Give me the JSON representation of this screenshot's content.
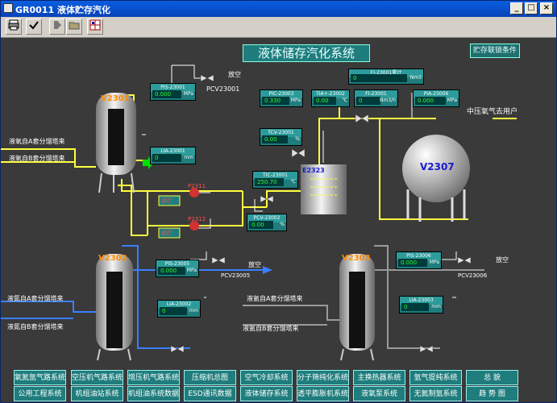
{
  "window": {
    "title": "GR0011  液体贮存汽化",
    "min_label": "_",
    "max_label": "□",
    "close_label": "×"
  },
  "toolbar": {
    "print_icon": "printer-icon",
    "check_icon": "check-icon",
    "fwd_icon": "forward-icon",
    "open_icon": "folder-icon",
    "grid_icon": "grid-icon"
  },
  "header": {
    "title": "液体储存汽化系统",
    "link_label": "贮存联锁条件"
  },
  "tanks": {
    "v2301": "V2301",
    "v2302": "V2302",
    "v2303": "V2303",
    "v2307": "V2307",
    "e2323": "E2323"
  },
  "inlets": {
    "top_a": "液氧自A套分馏塔来",
    "top_b": "液氧自B套分馏塔来",
    "mid_a": "液氮自A套分馏塔来",
    "mid_b": "液氮自B套分馏塔来",
    "right_a": "液氩自A套分馏塔来",
    "right_b": "液氩自B套分馏塔来"
  },
  "outlets": {
    "vent1": "放空",
    "vent2": "放空",
    "vent3": "放空",
    "user": "中压氧气去用户"
  },
  "valves": {
    "pcv23001": "PCV23001",
    "pcv23002": "PCV23002",
    "pcv23005": "PCV23005",
    "pcv23006": "PCV23006"
  },
  "pumps": {
    "p2311": "P2311",
    "p2312": "P2312",
    "p2311_state": "运行",
    "p2312_state": "运行"
  },
  "instruments": {
    "pis23001": {
      "tag": "PIS-23001",
      "value": "0.000",
      "unit": "MPa"
    },
    "lia23001": {
      "tag": "LIA-23001",
      "value": "0",
      "unit": "mm"
    },
    "pic23003": {
      "tag": "PIC-23003",
      "value": "0.330",
      "unit": "MPa"
    },
    "tia23002": {
      "tag": "TIA+-23002",
      "value": "0.00",
      "unit": "℃"
    },
    "fi23001": {
      "tag": "FI-23001",
      "value": "0",
      "unit": "Nm3/h"
    },
    "fi23001b": {
      "tag": "FI-23001累计",
      "value": "0",
      "unit": "Nm3"
    },
    "pia23006": {
      "tag": "PIA-23006",
      "value": "0.000",
      "unit": "MPa"
    },
    "tcv23001": {
      "tag": "TCV-23001",
      "value": "0.00",
      "unit": "%"
    },
    "tic23001": {
      "tag": "TIC-23001",
      "value": "250.70",
      "unit": "℃"
    },
    "pcv23002v": {
      "tag": "PCV-23002",
      "value": "0.00",
      "unit": "%"
    },
    "pis23005": {
      "tag": "PIS-23005",
      "value": "0.000",
      "unit": "MPa"
    },
    "lia23002": {
      "tag": "LIA-23002",
      "value": "0",
      "unit": "mm"
    },
    "pis23006": {
      "tag": "PIS-23006",
      "value": "0.000",
      "unit": "MPa"
    },
    "lia23003": {
      "tag": "LIA-23003",
      "value": "0",
      "unit": "mm"
    }
  },
  "nav": [
    {
      "top": "氧氮氩气路系统",
      "bottom": "公用工程系统"
    },
    {
      "top": "空压机气路系统",
      "bottom": "机组油站系统"
    },
    {
      "top": "增压机气路系统",
      "bottom": "机组油系统数据"
    },
    {
      "top": "压缩机总图",
      "bottom": "ESD通讯数据"
    },
    {
      "top": "空气冷却系统",
      "bottom": "液体储存系统"
    },
    {
      "top": "分子筛纯化系统",
      "bottom": "透平膨胀机系统"
    },
    {
      "top": "主换热器系统",
      "bottom": "液氧泵系统"
    },
    {
      "top": "氩气提纯系统",
      "bottom": "无氮制氩系统"
    },
    {
      "top": "总 貌",
      "bottom": "趋 势 图"
    }
  ]
}
